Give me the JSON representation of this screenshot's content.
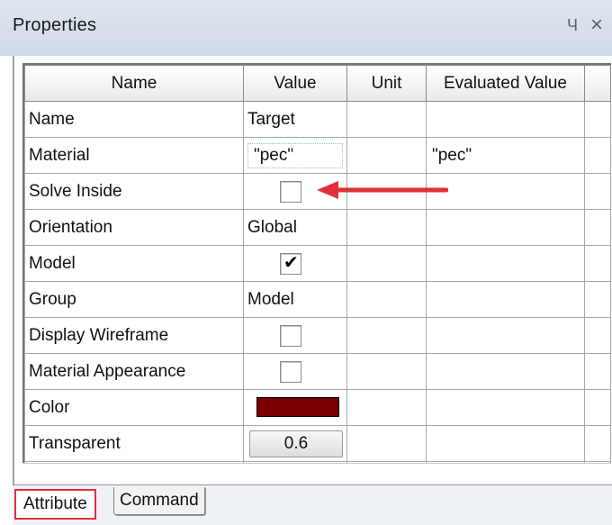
{
  "window": {
    "title": "Properties",
    "pin_glyph": "Ч",
    "close_glyph": "×"
  },
  "grid": {
    "columns": [
      "Name",
      "Value",
      "Unit",
      "Evaluated Value"
    ],
    "rows": [
      {
        "name": "Name",
        "value": "Target",
        "kind": "text",
        "unit": "",
        "evaluated": ""
      },
      {
        "name": "Material",
        "value": "\"pec\"",
        "kind": "material",
        "unit": "",
        "evaluated": "\"pec\""
      },
      {
        "name": "Solve Inside",
        "value": "",
        "kind": "checkbox",
        "checked": false,
        "unit": "",
        "evaluated": ""
      },
      {
        "name": "Orientation",
        "value": "Global",
        "kind": "text",
        "unit": "",
        "evaluated": ""
      },
      {
        "name": "Model",
        "value": "",
        "kind": "checkbox",
        "checked": true,
        "unit": "",
        "evaluated": ""
      },
      {
        "name": "Group",
        "value": "Model",
        "kind": "text",
        "unit": "",
        "evaluated": ""
      },
      {
        "name": "Display Wireframe",
        "value": "",
        "kind": "checkbox",
        "checked": false,
        "unit": "",
        "evaluated": ""
      },
      {
        "name": "Material Appearance",
        "value": "",
        "kind": "checkbox",
        "checked": false,
        "unit": "",
        "evaluated": ""
      },
      {
        "name": "Color",
        "value": "",
        "kind": "color",
        "color": "#7b0000",
        "unit": "",
        "evaluated": ""
      },
      {
        "name": "Transparent",
        "value": "0.6",
        "kind": "number",
        "unit": "",
        "evaluated": ""
      }
    ]
  },
  "tabs": [
    {
      "label": "Attribute",
      "active": true
    },
    {
      "label": "Command",
      "active": false
    }
  ],
  "colors": {
    "annotation_red": "#e0313a",
    "header_bg": "#d6dee9"
  }
}
